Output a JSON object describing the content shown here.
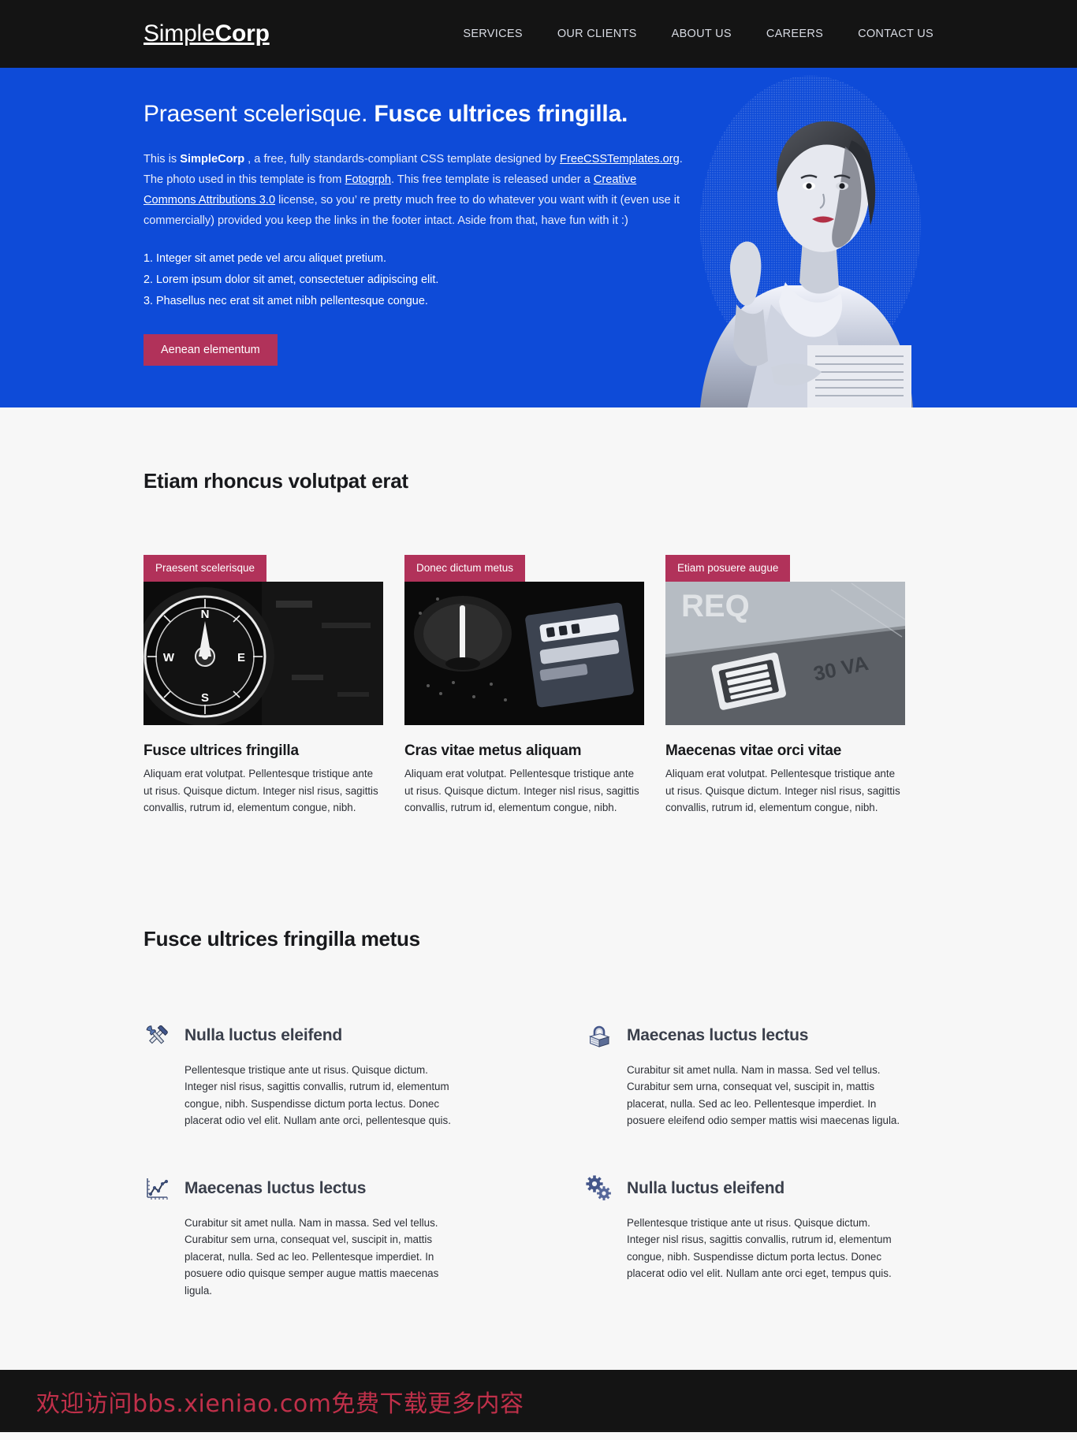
{
  "colors": {
    "header_bg": "#141414",
    "hero_bg": "#0e4bd8",
    "accent_crimson": "#b1325a",
    "page_bg": "#f7f7f7",
    "footer_text": "#c0304a"
  },
  "header": {
    "logo_light": "Simple",
    "logo_bold": "Corp",
    "nav": [
      {
        "label": "SERVICES"
      },
      {
        "label": "OUR CLIENTS"
      },
      {
        "label": "ABOUT US"
      },
      {
        "label": "CAREERS"
      },
      {
        "label": "CONTACT US"
      }
    ]
  },
  "hero": {
    "title_regular": "Praesent scelerisque. ",
    "title_bold": "Fusce ultrices fringilla.",
    "paragraph": {
      "p1": "This is ",
      "brand": "SimpleCorp",
      "p2": " , a free, fully standards-compliant CSS template designed by ",
      "link1": "FreeCSSTemplates.org",
      "p3": ". The photo used in this template is from ",
      "link2": "Fotogrph",
      "p4": ". This free template is released under a ",
      "link3": "Creative Commons Attributions 3.0",
      "p5": " license, so you’ re pretty much free to do whatever you want with it (even use it commercially) provided you keep the links in the footer intact. Aside from that, have fun with it :)"
    },
    "list": [
      {
        "num": "1.",
        "text": "Integer sit amet pede vel arcu aliquet pretium."
      },
      {
        "num": "2.",
        "text": "Lorem ipsum dolor sit amet, consectetuer adipiscing elit."
      },
      {
        "num": "3.",
        "text": "Phasellus nec erat sit amet nibh pellentesque congue."
      }
    ],
    "button_label": "Aenean elementum",
    "photo_alt": "woman-portrait-photo"
  },
  "cards_section": {
    "title": "Etiam rhoncus volutpat erat",
    "cards": [
      {
        "tag": "Praesent scelerisque",
        "title": "Fusce ultrices fringilla",
        "body": "Aliquam erat volutpat. Pellentesque tristique ante ut risus. Quisque dictum. Integer nisl risus, sagittis convallis, rutrum id, elementum congue, nibh.",
        "photo_alt": "compass-photo"
      },
      {
        "tag": "Donec dictum metus",
        "title": "Cras vitae metus aliquam",
        "body": "Aliquam erat volutpat. Pellentesque tristique ante ut risus. Quisque dictum. Integer nisl risus, sagittis convallis, rutrum id, elementum congue, nibh.",
        "photo_alt": "audio-equipment-photo"
      },
      {
        "tag": "Etiam posuere augue",
        "title": "Maecenas vitae orci vitae",
        "body": "Aliquam erat volutpat. Pellentesque tristique ante ut risus. Quisque dictum. Integer nisl risus, sagittis convallis, rutrum id, elementum congue, nibh.",
        "photo_alt": "control-panel-photo"
      }
    ]
  },
  "features_section": {
    "title": "Fusce ultrices fringilla metus",
    "features": [
      {
        "icon": "tools-icon",
        "title": "Nulla luctus eleifend",
        "body": "Pellentesque tristique ante ut risus. Quisque dictum. Integer nisl risus, sagittis convallis, rutrum id, elementum congue, nibh. Suspendisse dictum porta lectus. Donec placerat odio vel elit. Nullam ante orci, pellentesque quis."
      },
      {
        "icon": "padlock-icon",
        "title": "Maecenas luctus lectus",
        "body": "Curabitur sit amet nulla. Nam in massa. Sed vel tellus. Curabitur sem urna, consequat vel, suscipit in, mattis placerat, nulla. Sed ac leo. Pellentesque imperdiet. In posuere eleifend odio semper mattis wisi maecenas ligula."
      },
      {
        "icon": "line-chart-icon",
        "title": "Maecenas luctus lectus",
        "body": "Curabitur sit amet nulla. Nam in massa. Sed vel tellus. Curabitur sem urna, consequat vel, suscipit in, mattis placerat, nulla. Sed ac leo. Pellentesque imperdiet. In posuere odio quisque semper augue mattis maecenas ligula."
      },
      {
        "icon": "gears-icon",
        "title": "Nulla luctus eleifend",
        "body": "Pellentesque tristique ante ut risus. Quisque dictum. Integer nisl risus, sagittis convallis, rutrum id, elementum congue, nibh. Suspendisse dictum porta lectus. Donec placerat odio vel elit. Nullam ante orci eget, tempus quis."
      }
    ]
  },
  "footer": {
    "text": "欢迎访问bbs.xieniao.com免费下载更多内容"
  }
}
